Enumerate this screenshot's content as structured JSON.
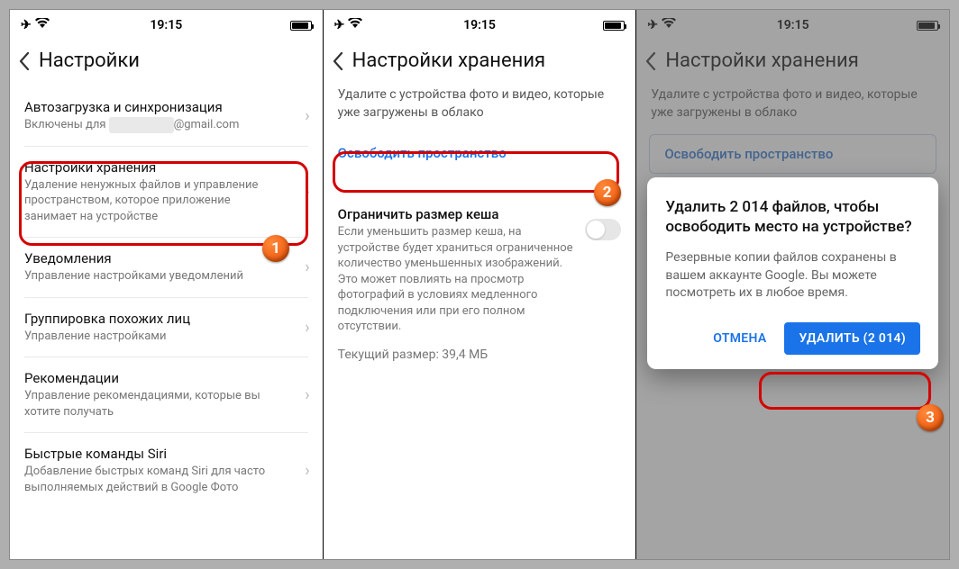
{
  "statusbar": {
    "time": "19:15"
  },
  "screen1": {
    "title": "Настройки",
    "rows": {
      "autoupload": {
        "title": "Автозагрузка и синхронизация",
        "sub_prefix": "Включены для ",
        "sub_suffix": "@gmail.com"
      },
      "storage": {
        "title": "Настройки хранения",
        "sub": "Удаление ненужных файлов и управление пространством, которое приложение занимает на устройстве"
      },
      "notif": {
        "title": "Уведомления",
        "sub": "Управление настройками уведомлений"
      },
      "faces": {
        "title": "Группировка похожих лиц",
        "sub": "Управление настройками"
      },
      "recs": {
        "title": "Рекомендации",
        "sub": "Управление рекомендациями, которые вы хотите получать"
      },
      "siri": {
        "title": "Быстрые команды Siri",
        "sub": "Добавление быстрых команд Siri для часто выполняемых действий в Google Фото"
      }
    }
  },
  "screen2": {
    "title": "Настройки хранения",
    "help": "Удалите с устройства фото и видео, которые уже загружены в облако",
    "freeup": "Освободить пространство",
    "cache_title": "Ограничить размер кеша",
    "cache_sub": "Если уменьшить размер кеша, на устройстве будет храниться ограниченное количество уменьшенных изображений. Это может повлиять на просмотр фотографий в условиях медленного подключения или при его полном отсутствии.",
    "cache_size": "Текущий размер: 39,4 МБ"
  },
  "screen3": {
    "title": "Настройки хранения",
    "help": "Удалите с устройства фото и видео, которые уже загружены в облако",
    "freeup": "Освободить пространство",
    "dialog_title": "Удалить 2 014 файлов, чтобы освободить место на устройстве?",
    "dialog_body": "Резервные копии файлов сохранены в вашем аккаунте Google. Вы можете посмотреть их в любое время.",
    "cancel": "ОТМЕНА",
    "delete": "УДАЛИТЬ (2 014)"
  },
  "badges": {
    "one": "1",
    "two": "2",
    "three": "3"
  }
}
